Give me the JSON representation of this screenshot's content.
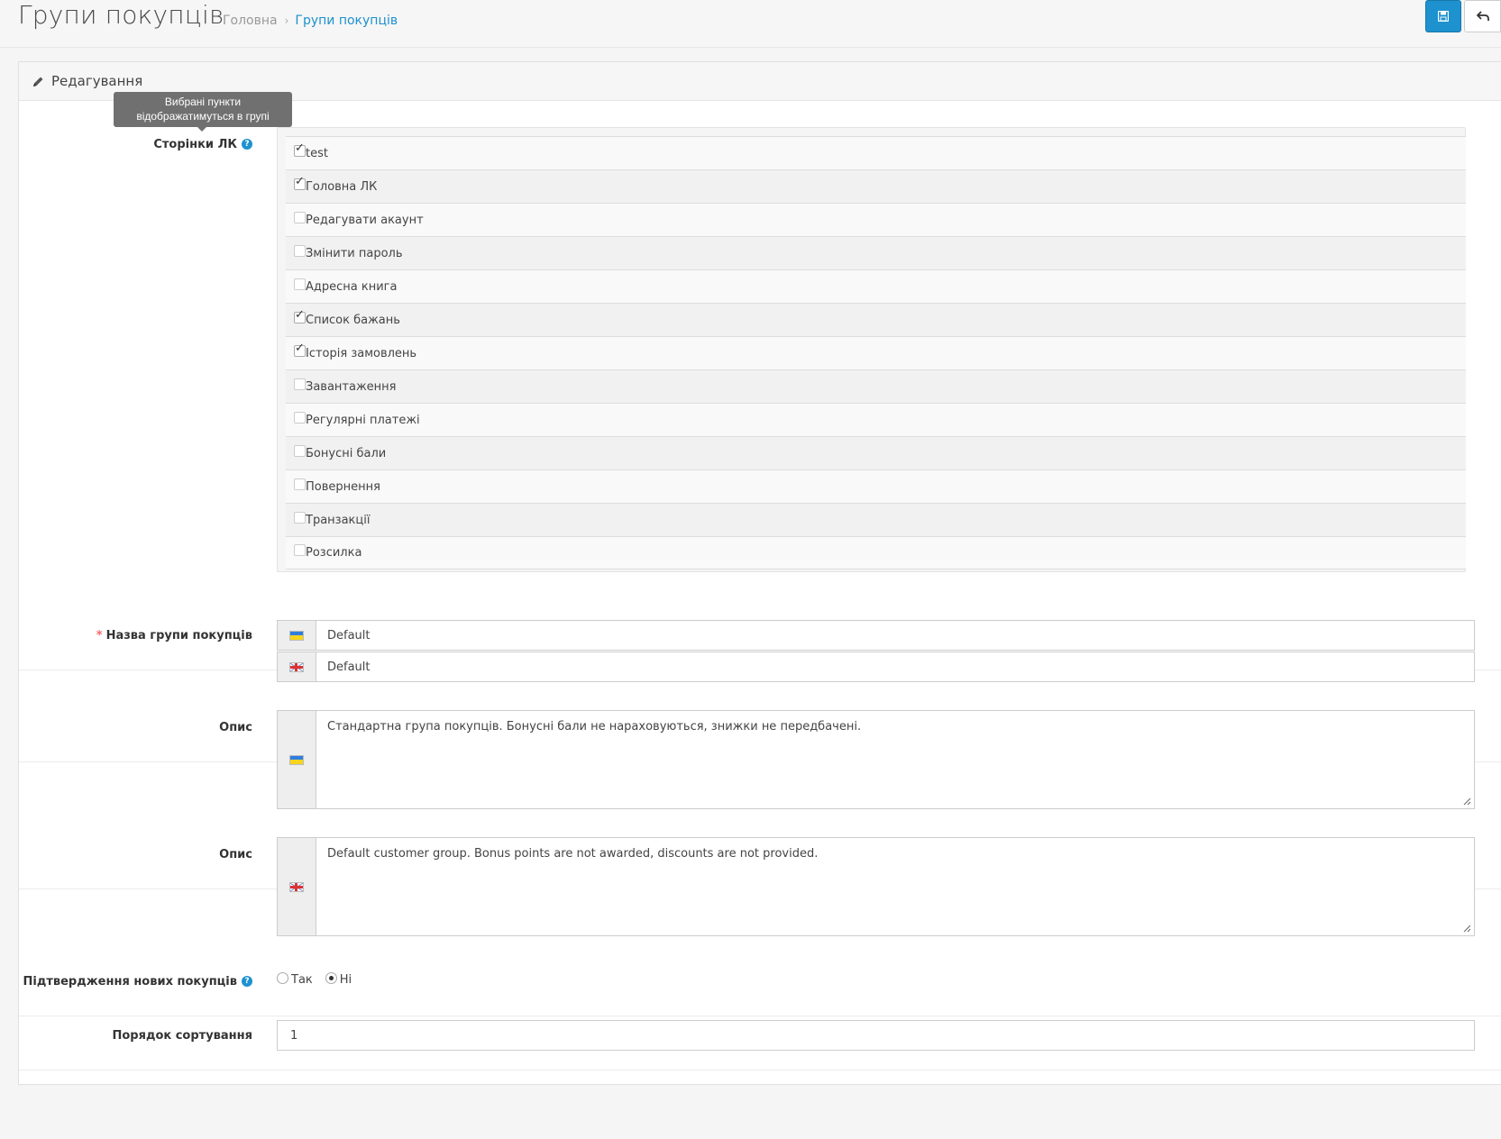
{
  "header": {
    "title": "Групи покупців",
    "breadcrumb": [
      {
        "label": "Головна"
      },
      {
        "label": "Групи покупців"
      }
    ],
    "save_icon": "floppy-disk-icon",
    "back_icon": "reply-arrow-icon",
    "accent_color": "#1e91cf"
  },
  "panel": {
    "heading": "Редагування",
    "heading_icon": "pencil-icon"
  },
  "tooltip": {
    "line1": "Вибрані пункти",
    "line2": "відображатимуться в групі"
  },
  "pages": {
    "label": "Сторінки ЛК",
    "help": "?",
    "items": [
      {
        "label": "test",
        "checked": true
      },
      {
        "label": "Головна ЛК",
        "checked": true
      },
      {
        "label": "Редагувати акаунт",
        "checked": false
      },
      {
        "label": "Змінити пароль",
        "checked": false
      },
      {
        "label": "Адресна книга",
        "checked": false
      },
      {
        "label": "Список бажань",
        "checked": true
      },
      {
        "label": "Історія замовлень",
        "checked": true
      },
      {
        "label": "Завантаження",
        "checked": false
      },
      {
        "label": "Регулярні платежі",
        "checked": false
      },
      {
        "label": "Бонусні бали",
        "checked": false
      },
      {
        "label": "Повернення",
        "checked": false
      },
      {
        "label": "Транзакції",
        "checked": false
      },
      {
        "label": "Розсилка",
        "checked": false
      }
    ]
  },
  "group_name": {
    "required_mark": "*",
    "label": "Назва групи покупців",
    "ua_value": "Default",
    "en_value": "Default"
  },
  "description_ua": {
    "label": "Опис",
    "value": "Стандартна група покупців. Бонусні бали не нараховуються, знижки не передбачені."
  },
  "description_en": {
    "label": "Опис",
    "value": "Default customer group. Bonus points are not awarded, discounts are not provided."
  },
  "approval": {
    "label": "Підтвердження нових покупців",
    "help": "?",
    "yes_label": "Так",
    "no_label": "Ні",
    "selected": "no"
  },
  "sort_order": {
    "label": "Порядок сортування",
    "value": "1"
  }
}
